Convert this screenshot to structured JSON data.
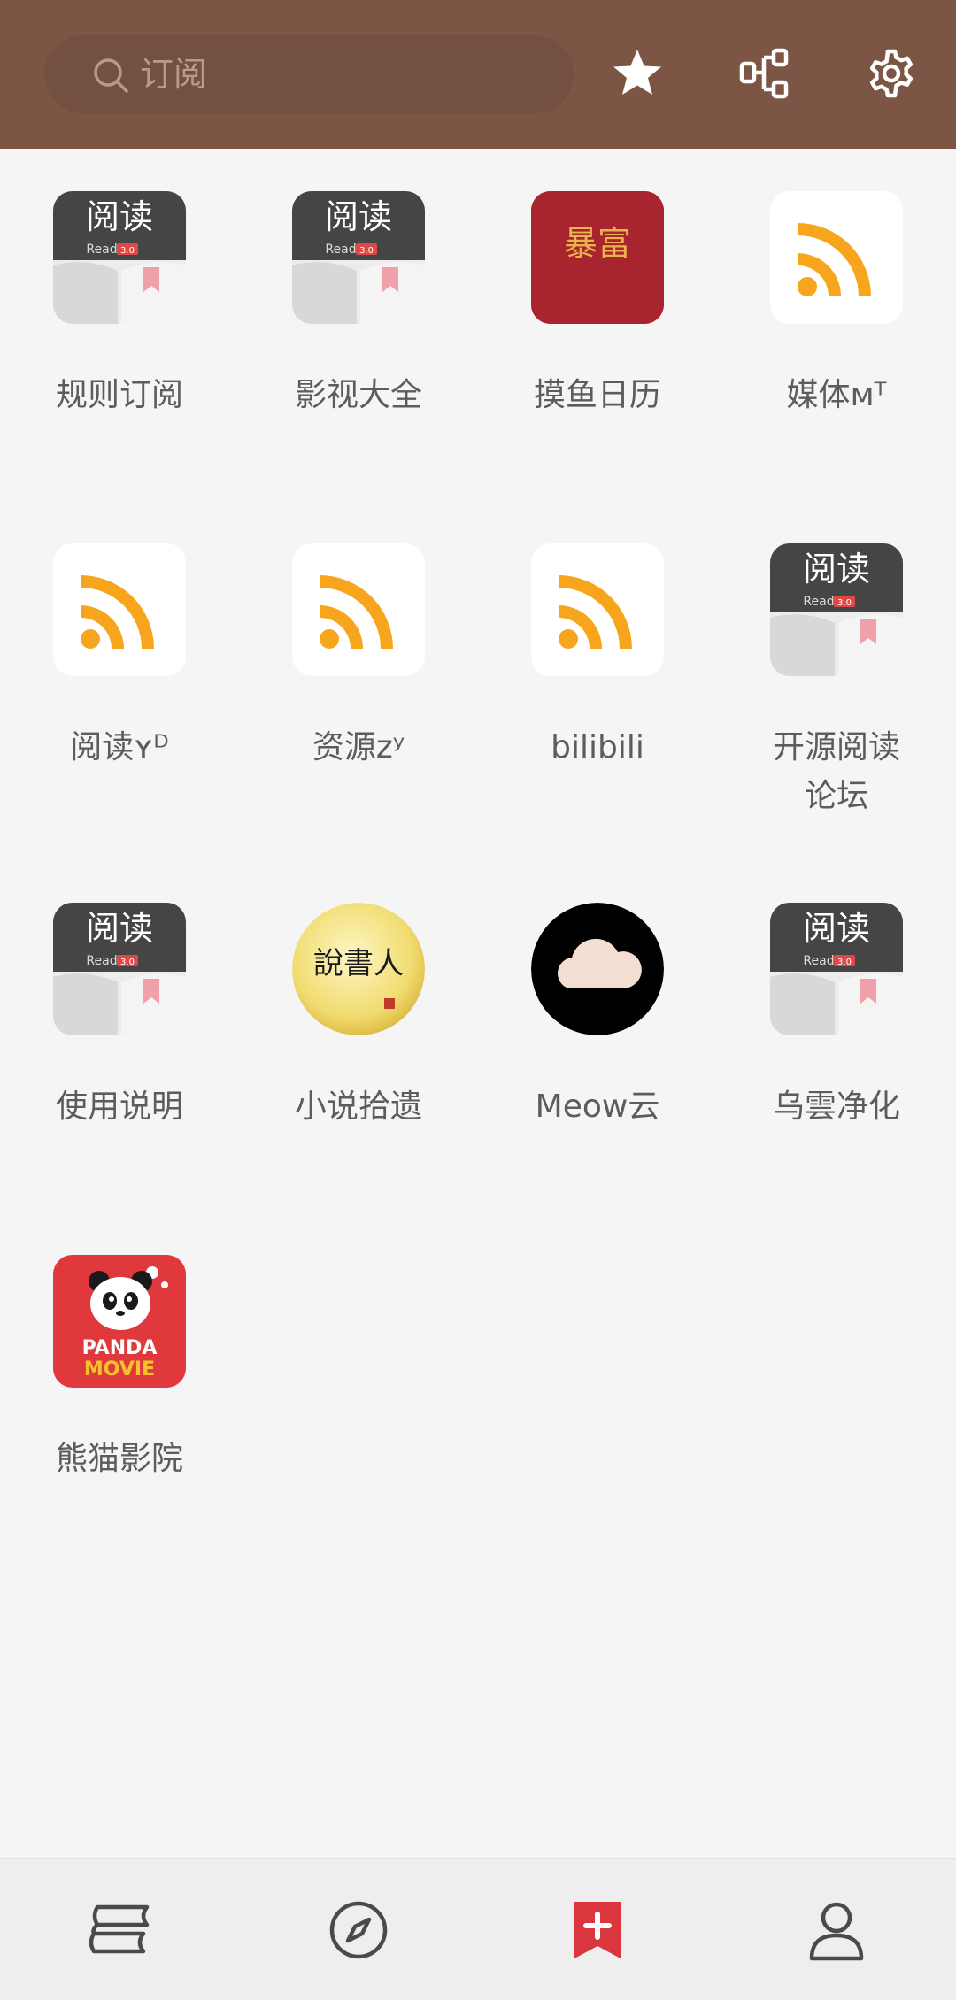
{
  "search": {
    "placeholder": "订阅"
  },
  "colors": {
    "header": "#7d5544",
    "accent": "#d9363e",
    "rss": "#f7a51c",
    "background": "#f5f5f5"
  },
  "header_actions": [
    {
      "icon": "star-icon"
    },
    {
      "icon": "tree-structure-icon"
    },
    {
      "icon": "gear-icon"
    }
  ],
  "sources": [
    {
      "label": "规则订阅",
      "icon": "read-app-icon"
    },
    {
      "label": "影视大全",
      "icon": "read-app-icon"
    },
    {
      "label": "摸鱼日历",
      "icon": "calendar-icon",
      "icon_text": "暴富"
    },
    {
      "label": "媒体ᴍᵀ",
      "icon": "rss-icon"
    },
    {
      "label": "阅读ʏᴰ",
      "icon": "rss-icon"
    },
    {
      "label": "资源zʸ",
      "icon": "rss-icon"
    },
    {
      "label": "bilibili",
      "icon": "rss-icon"
    },
    {
      "label": "开源阅读\n论坛",
      "icon": "read-app-icon"
    },
    {
      "label": "使用说明",
      "icon": "read-app-icon"
    },
    {
      "label": "小说拾遗",
      "icon": "storyteller-icon",
      "icon_text": "說書人"
    },
    {
      "label": "Meow云",
      "icon": "cloud-icon"
    },
    {
      "label": "乌雲净化",
      "icon": "read-app-icon"
    },
    {
      "label": "熊猫影院",
      "icon": "panda-movie-icon",
      "icon_text": [
        "PANDA",
        "MOVIE"
      ]
    }
  ],
  "read_app_icon_text": {
    "main": "阅读",
    "sub": "Read",
    "version": "3.0"
  },
  "bottom_nav": [
    {
      "icon": "bookshelf-icon",
      "active": false
    },
    {
      "icon": "compass-icon",
      "active": false
    },
    {
      "icon": "subscribe-icon",
      "active": true
    },
    {
      "icon": "user-icon",
      "active": false
    }
  ]
}
